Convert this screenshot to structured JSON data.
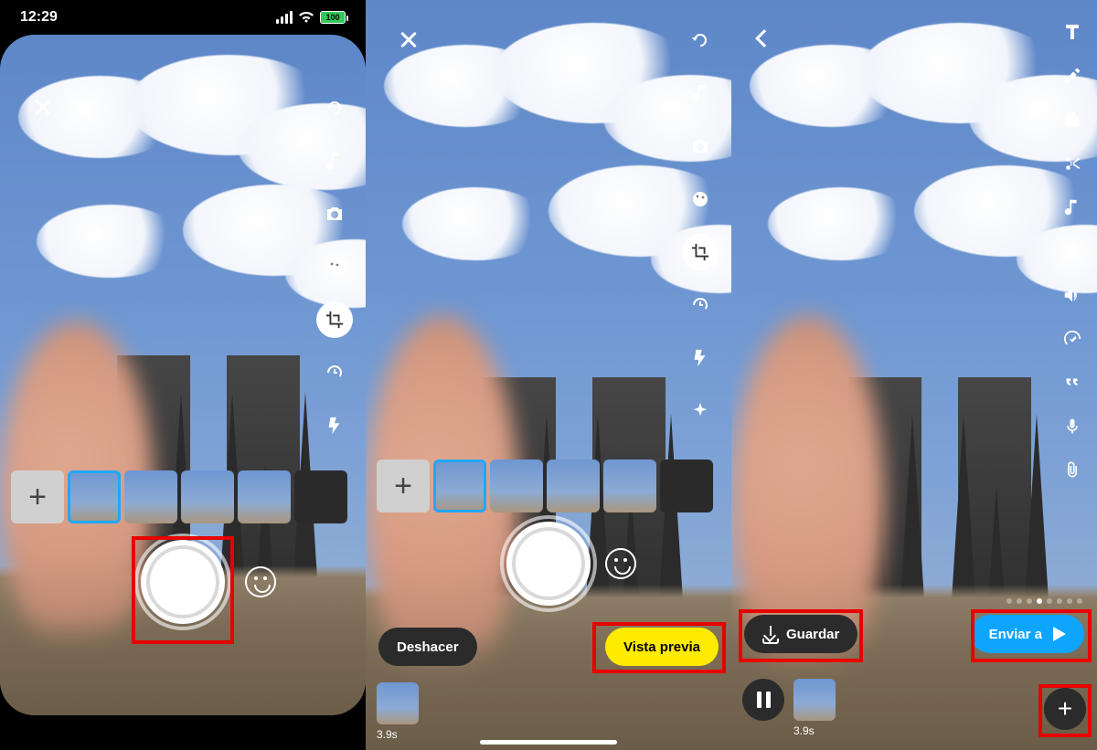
{
  "status": {
    "time": "12:29",
    "battery": "100"
  },
  "screen1": {
    "tools": [
      "flip",
      "music",
      "camera",
      "palette",
      "crop",
      "speed",
      "flash"
    ],
    "active_tool_index": 4,
    "thumb_count": 6
  },
  "screen2": {
    "tools": [
      "flip",
      "music",
      "camera",
      "palette",
      "crop",
      "speed",
      "flash",
      "sparkle"
    ],
    "active_tool_index": 4,
    "undo_label": "Deshacer",
    "preview_label": "Vista previa",
    "clip_duration": "3.9s",
    "thumb_count": 6
  },
  "screen3": {
    "tools": [
      "text",
      "pencil",
      "sticker",
      "scissors",
      "music",
      "tag",
      "volume",
      "magic",
      "quote",
      "mic",
      "attach"
    ],
    "save_label": "Guardar",
    "send_label": "Enviar a",
    "clip_duration": "3.9s",
    "dot_count": 8,
    "dot_active": 3
  }
}
